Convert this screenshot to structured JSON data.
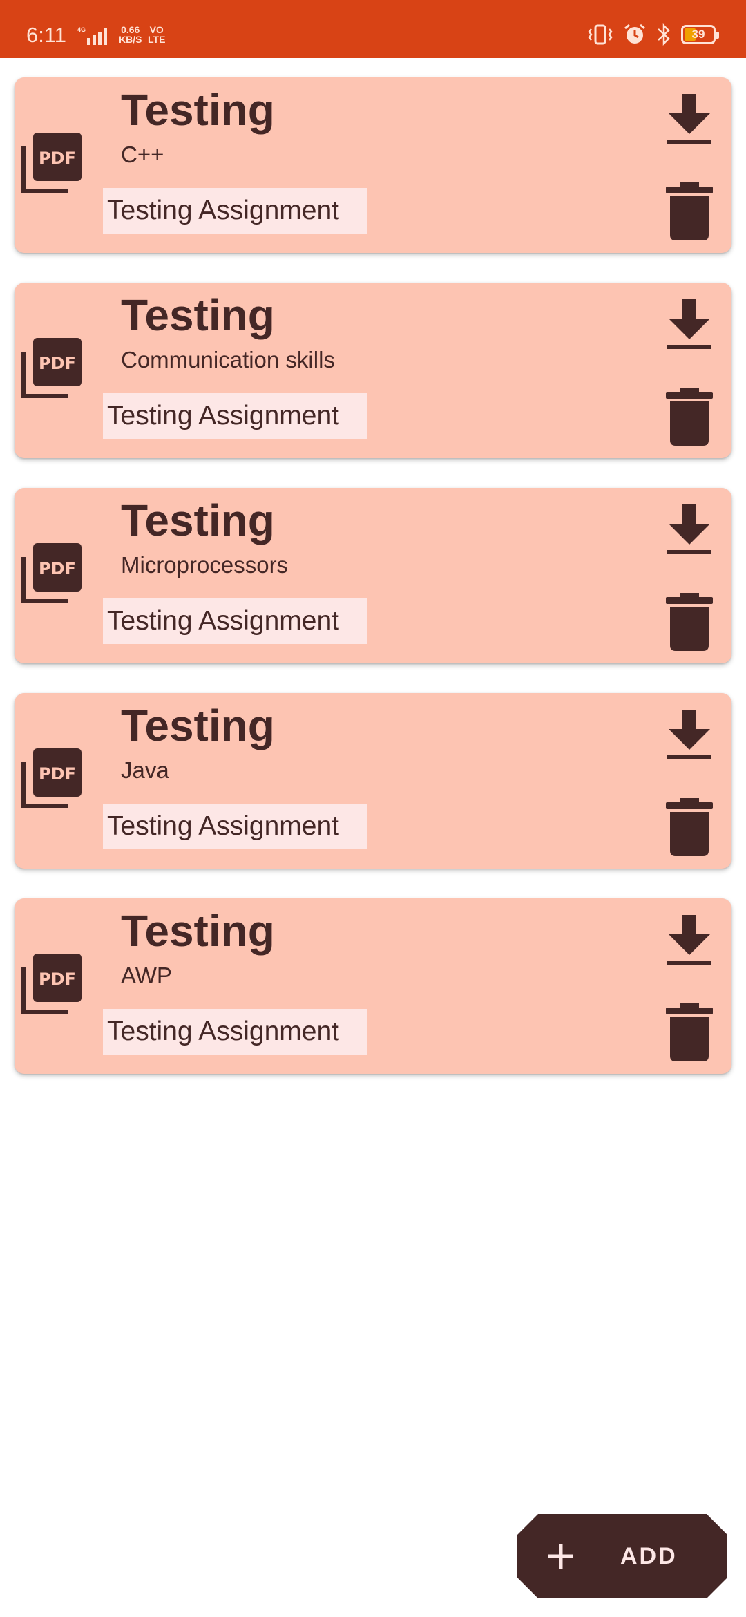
{
  "status_bar": {
    "time": "6:11",
    "network": "4G",
    "speed_value": "0.66",
    "speed_unit": "KB/S",
    "volte_top": "VO",
    "volte_bottom": "LTE",
    "battery": "39",
    "battery_fraction": 0.39
  },
  "assignments": [
    {
      "title": "Testing",
      "subject": "C++",
      "description": "Testing Assignment"
    },
    {
      "title": "Testing",
      "subject": "Communication skills",
      "description": "Testing Assignment"
    },
    {
      "title": "Testing",
      "subject": "Microprocessors",
      "description": "Testing Assignment"
    },
    {
      "title": "Testing",
      "subject": "Java",
      "description": "Testing Assignment"
    },
    {
      "title": "Testing",
      "subject": "AWP",
      "description": "Testing Assignment"
    }
  ],
  "pdf_icon_label": "PDF",
  "fab": {
    "label": "ADD"
  },
  "colors": {
    "status_bar": "#d84315",
    "card": "#fdc4b2",
    "chip": "#fde7e6",
    "foreground": "#442726"
  },
  "icons": {
    "file": "pdf-icon",
    "download": "download-icon",
    "delete": "trash-icon",
    "add": "plus-icon"
  }
}
